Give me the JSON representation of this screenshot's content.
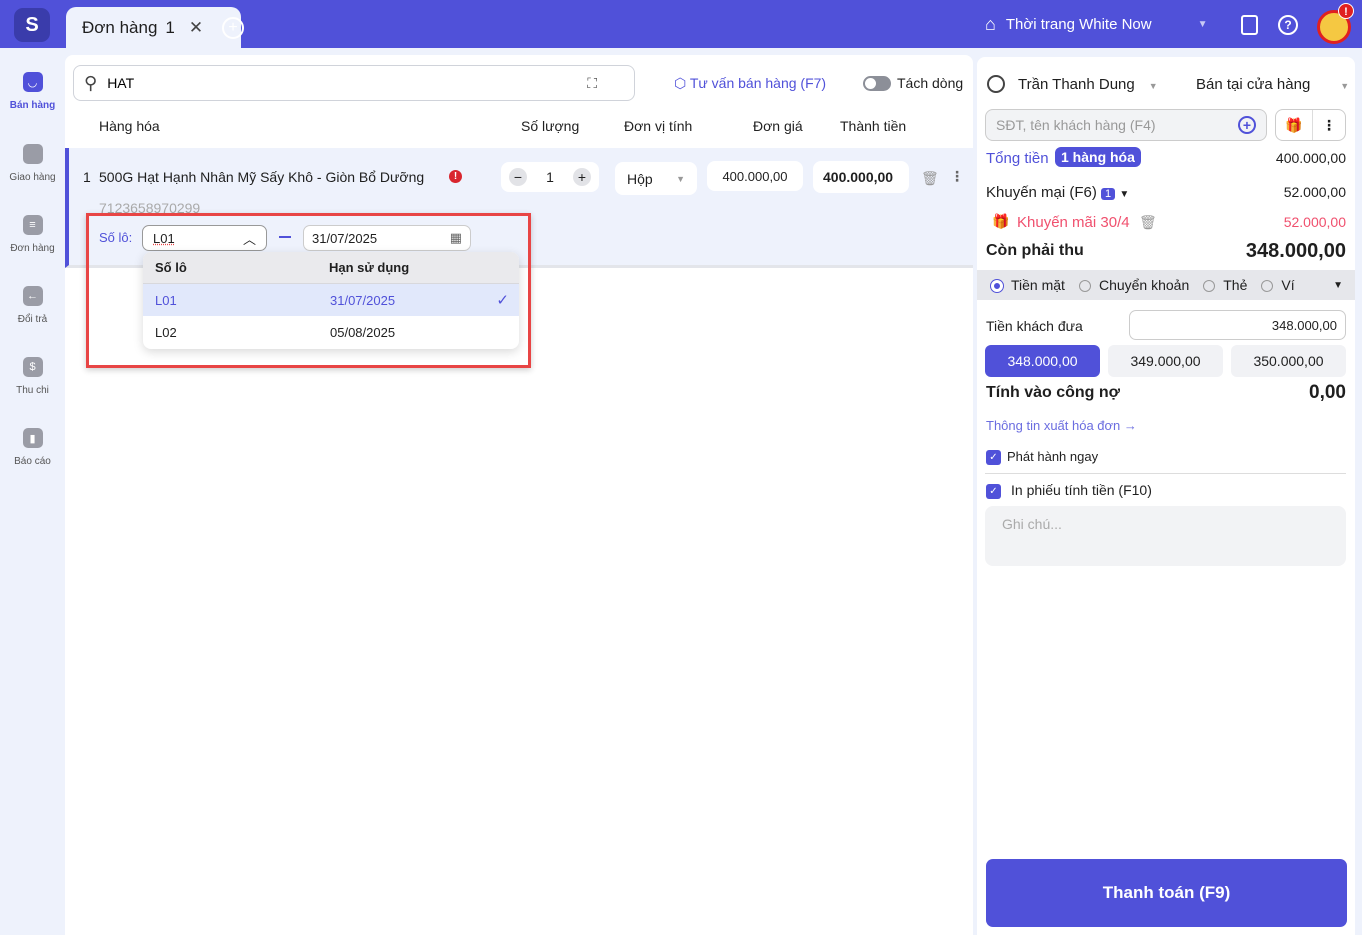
{
  "topbar": {
    "logo": "S",
    "tab_label": "Đơn hàng",
    "tab_number": "1",
    "store_name": "Thời trang White Now",
    "badge": "!"
  },
  "sidebar": {
    "items": [
      {
        "label": "Bán hàng",
        "icon": "shopping-bag-icon"
      },
      {
        "label": "Giao hàng",
        "icon": "truck-icon"
      },
      {
        "label": "Đơn hàng",
        "icon": "document-icon"
      },
      {
        "label": "Đổi trả",
        "icon": "return-icon"
      },
      {
        "label": "Thu chi",
        "icon": "cash-icon"
      },
      {
        "label": "Báo cáo",
        "icon": "chart-icon"
      }
    ]
  },
  "search": {
    "value": "HAT"
  },
  "toolbar": {
    "advisor": "Tư vấn bán hàng (F7)",
    "split": "Tách dòng"
  },
  "table": {
    "headers": [
      "Hàng hóa",
      "Số lượng",
      "Đơn vị tính",
      "Đơn giá",
      "Thành tiền"
    ],
    "row": {
      "index": "1",
      "name": "500G Hạt Hạnh Nhân Mỹ Sấy Khô - Giòn Bổ Dưỡng",
      "code": "7123658970299",
      "qty": "1",
      "unit": "Hộp",
      "price": "400.000,00",
      "total": "400.000,00"
    }
  },
  "batch": {
    "label": "Số lô:",
    "value": "L01",
    "expiry": "31/07/2025",
    "dropdown": {
      "headers": [
        "Số lô",
        "Hạn sử dụng"
      ],
      "rows": [
        {
          "lot": "L01",
          "expiry": "31/07/2025",
          "selected": true
        },
        {
          "lot": "L02",
          "expiry": "05/08/2025",
          "selected": false
        }
      ]
    }
  },
  "right": {
    "seller": "Trần Thanh Dung",
    "channel": "Bán tại cửa hàng",
    "customer_placeholder": "SĐT, tên khách hàng (F4)",
    "total_label": "Tổng tiền",
    "items_badge": "1 hàng hóa",
    "total": "400.000,00",
    "promo_label": "Khuyến mại (F6)",
    "promo_count": "1",
    "promo_amount": "52.000,00",
    "promo_name": "Khuyến mãi 30/4",
    "promo_name_amount": "52.000,00",
    "due_label": "Còn phải thu",
    "due": "348.000,00",
    "methods": [
      "Tiền mặt",
      "Chuyển khoản",
      "Thẻ",
      "Ví"
    ],
    "paid_label": "Tiền khách đưa",
    "paid": "348.000,00",
    "quick": [
      "348.000,00",
      "349.000,00",
      "350.000,00"
    ],
    "debt_label": "Tính vào công nợ",
    "debt": "0,00",
    "invoice_link": "Thông tin xuất hóa đơn →",
    "issue_now": "Phát hành ngay",
    "print": "In phiếu tính tiền (F10)",
    "note_placeholder": "Ghi chú...",
    "pay_button": "Thanh toán (F9)"
  },
  "colors": {
    "accent": "#5051d9",
    "danger": "#e84545",
    "promo": "#f0506e"
  }
}
